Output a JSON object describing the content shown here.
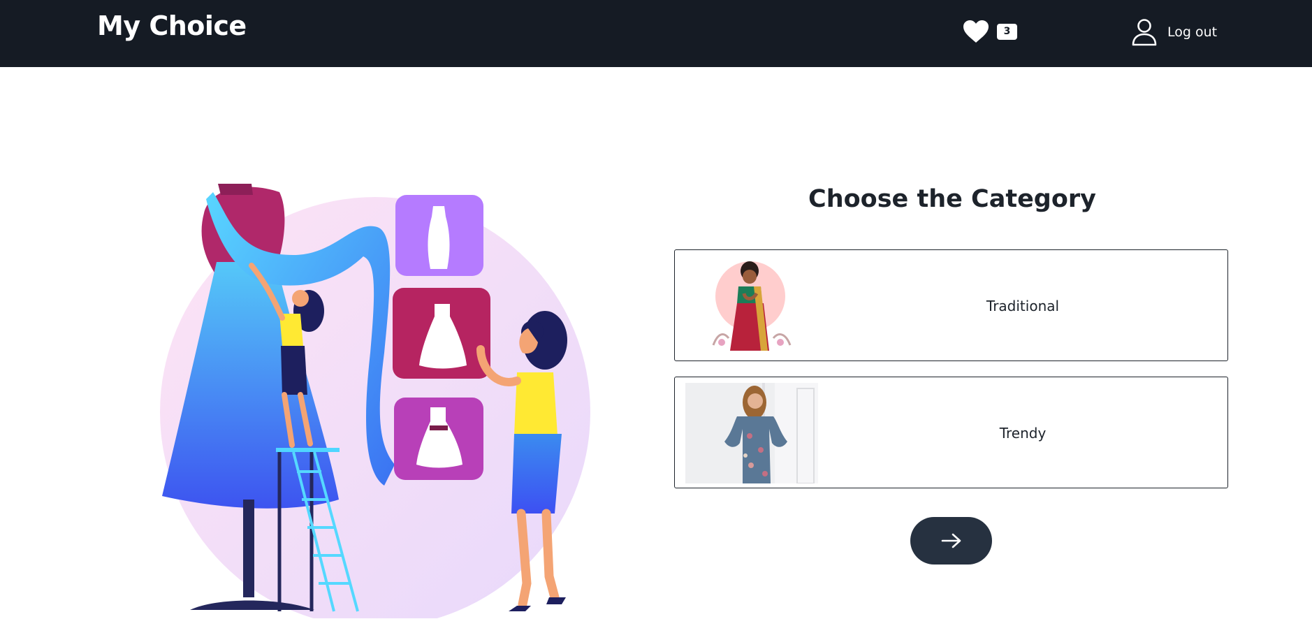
{
  "header": {
    "brand": "My Choice",
    "favorites": {
      "icon": "heart-icon",
      "count": "3"
    },
    "user": {
      "icon": "user-icon",
      "logout_label": "Log out"
    }
  },
  "main": {
    "heading": "Choose the Category",
    "categories": [
      {
        "label": "Traditional",
        "image": "woman-in-saree"
      },
      {
        "label": "Trendy",
        "image": "woman-in-floral-dress"
      }
    ],
    "next_button": {
      "icon": "arrow-right-icon"
    }
  },
  "colors": {
    "navbar_bg": "#151b24",
    "button_bg": "#263140",
    "text_dark": "#1d232b"
  }
}
